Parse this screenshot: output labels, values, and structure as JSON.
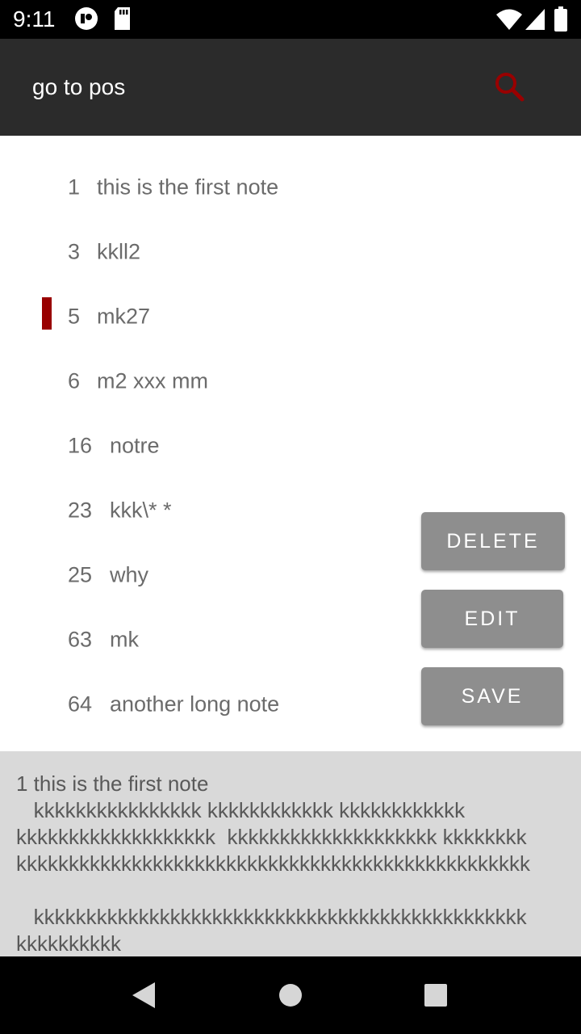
{
  "status_bar": {
    "time": "9:11",
    "icons": [
      "app-notification-icon",
      "sd-card-icon",
      "wifi-icon",
      "signal-icon",
      "battery-icon"
    ]
  },
  "app_bar": {
    "title": "go to pos",
    "search_icon": "search-icon",
    "accent_color": "#990000"
  },
  "notes": [
    {
      "num": "1",
      "text": "this is the first note",
      "selected": false
    },
    {
      "num": "3",
      "text": "kkll2",
      "selected": false
    },
    {
      "num": "5",
      "text": "mk27",
      "selected": true
    },
    {
      "num": "6",
      "text": "m2 xxx mm",
      "selected": false
    },
    {
      "num": "16",
      "text": "notre",
      "selected": false
    },
    {
      "num": "23",
      "text": "kkk\\* *",
      "selected": false
    },
    {
      "num": "25",
      "text": "why",
      "selected": false
    },
    {
      "num": "63",
      "text": "mk",
      "selected": false
    },
    {
      "num": "64",
      "text": "another long note",
      "selected": false
    }
  ],
  "actions": {
    "delete_label": "DELETE",
    "edit_label": "EDIT",
    "save_label": "SAVE"
  },
  "detail": {
    "text": "1 this is the first note\n   kkkkkkkkkkkkkkkk kkkkkkkkkkkk kkkkkkkkkkkk\nkkkkkkkkkkkkkkkkkkk  kkkkkkkkkkkkkkkkkkkk kkkkkkkk\nkkkkkkkkkkkkkkkkkkkkkkkkkkkkkkkkkkkkkkkkkkkkkkkkk\n\n   kkkkkkkkkkkkkkkkkkkkkkkkkkkkkkkkkkkkkkkkkkkkkkk\nkkkkkkkkkk"
  },
  "nav_bar": {
    "icons": [
      "back-icon",
      "home-icon",
      "recents-icon"
    ]
  }
}
